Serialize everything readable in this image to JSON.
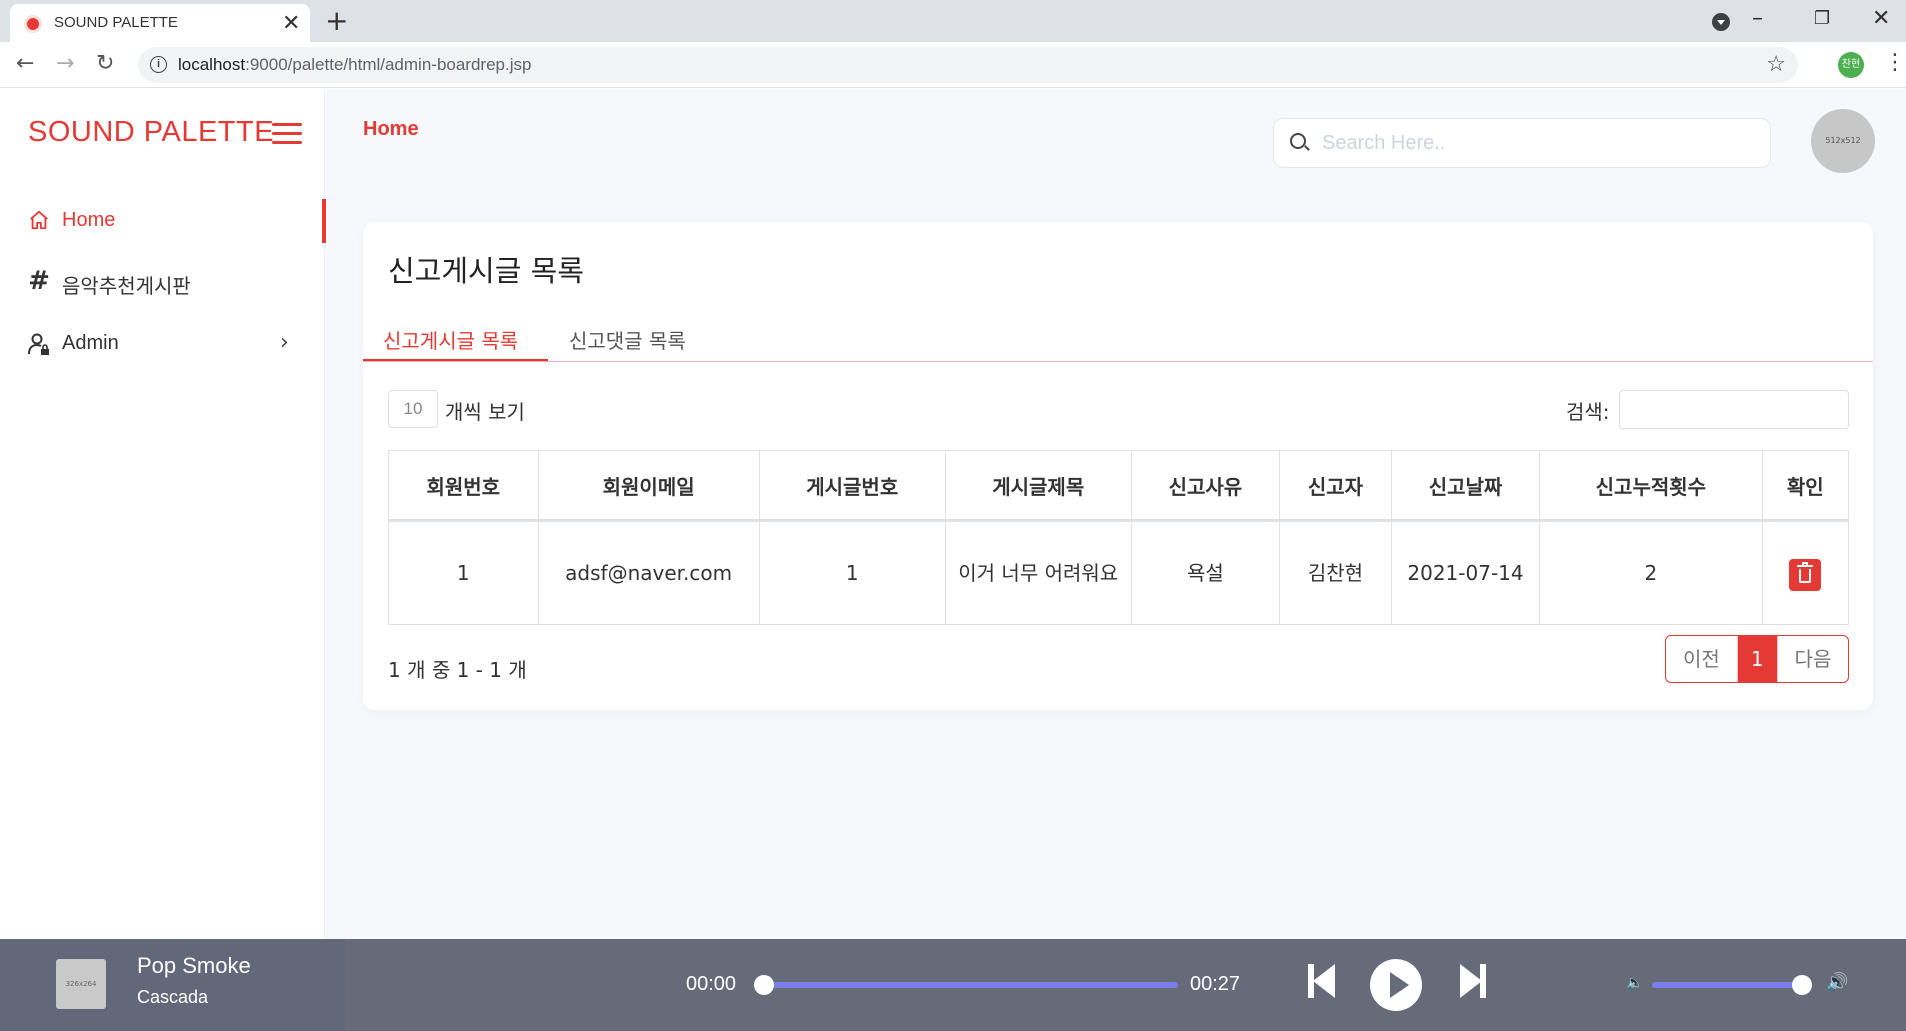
{
  "browser": {
    "tab_title": "SOUND PALETTE",
    "tab_close": "✕",
    "new_tab": "+",
    "url_host": "localhost",
    "url_path": ":9000/palette/html/admin-boardrep.jsp",
    "profile_initials": "찬현",
    "win_minimize": "–",
    "win_restore": "❐",
    "win_close": "✕"
  },
  "sidebar": {
    "brand": "SOUND PALETTE",
    "items": [
      {
        "label": "Home",
        "icon": "home-icon",
        "active": true
      },
      {
        "label": "음악추천게시판",
        "icon": "hash-icon",
        "active": false
      },
      {
        "label": "Admin",
        "icon": "user-lock-icon",
        "active": false
      }
    ]
  },
  "header": {
    "breadcrumb": "Home",
    "search_placeholder": "Search Here..",
    "avatar_text": "512x512"
  },
  "card": {
    "title": "신고게시글 목록",
    "tabs": [
      {
        "label": "신고게시글 목록",
        "active": true
      },
      {
        "label": "신고댓글 목록",
        "active": false
      }
    ],
    "page_length": "10",
    "page_length_label": "개씩 보기",
    "filter_label": "검색:",
    "table": {
      "columns": [
        "회원번호",
        "회원이메일",
        "게시글번호",
        "게시글제목",
        "신고사유",
        "신고자",
        "신고날짜",
        "신고누적횟수",
        "확인"
      ],
      "rows": [
        {
          "member_no": "1",
          "email": "adsf@naver.com",
          "post_no": "1",
          "post_title": "이거 너무 어려워요",
          "reason": "욕설",
          "reporter": "김찬현",
          "date": "2021-07-14",
          "count": "2"
        }
      ]
    },
    "info": "1 개 중 1 - 1 개",
    "pager": {
      "prev": "이전",
      "current": "1",
      "next": "다음"
    }
  },
  "player": {
    "thumb_text": "326x264",
    "title": "Pop Smoke",
    "artist": "Cascada",
    "current_time": "00:00",
    "duration": "00:27",
    "progress": 0,
    "volume": 1.0,
    "accent": "#7b7ee8"
  },
  "colors": {
    "brand": "#e53935",
    "player_bg": "#676b79",
    "page_bg": "#f7f8fb"
  }
}
